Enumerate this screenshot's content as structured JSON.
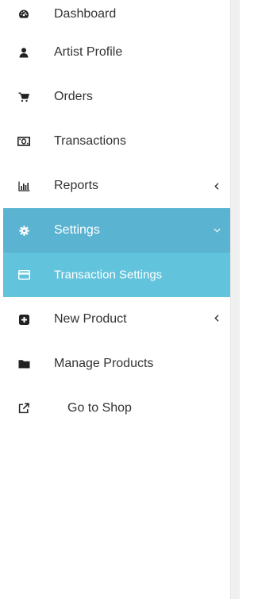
{
  "sidebar": {
    "items": [
      {
        "label": "Dashboard",
        "icon": "dashboard-gauge-icon"
      },
      {
        "label": "Artist Profile",
        "icon": "user-icon"
      },
      {
        "label": "Orders",
        "icon": "shopping-cart-icon"
      },
      {
        "label": "Transactions",
        "icon": "money-icon"
      },
      {
        "label": "Reports",
        "icon": "bar-chart-icon",
        "chevron": "chevron-left-icon"
      },
      {
        "label": "Settings",
        "icon": "gear-icon",
        "chevron": "chevron-down-icon",
        "state": "expanded"
      },
      {
        "label": "Transaction Settings",
        "icon": "credit-card-icon",
        "state": "selected"
      },
      {
        "label": "New Product",
        "icon": "plus-square-icon",
        "chevron": "chevron-left-icon"
      },
      {
        "label": "Manage Products",
        "icon": "folder-icon"
      },
      {
        "label": "Go to Shop",
        "icon": "external-link-icon"
      }
    ]
  },
  "colors": {
    "text": "#333333",
    "active_bg": "#5ab3d0",
    "selected_bg": "#62c3dc",
    "active_text": "#ffffff"
  }
}
